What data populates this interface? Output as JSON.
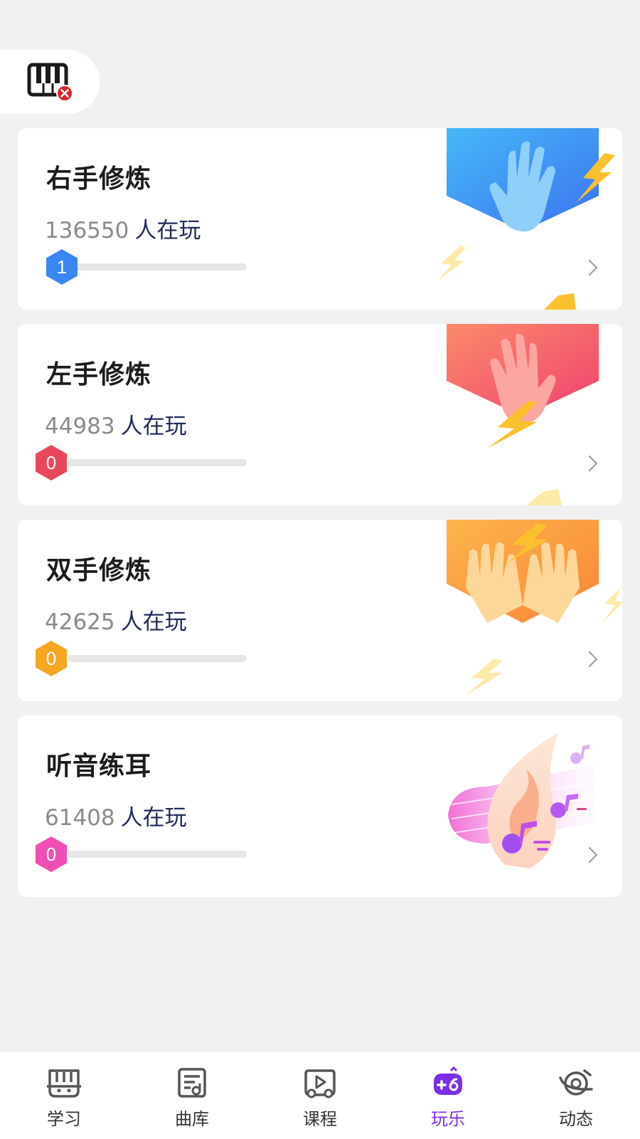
{
  "top": {
    "piano_status_icon": "piano-disconnected-icon"
  },
  "cards": [
    {
      "title": "右手修炼",
      "players": "136550",
      "players_suffix": "人在玩",
      "level": "1",
      "level_color": "#3a86f0",
      "art_icon": "right-hand-icon",
      "art_colors": [
        "#4ab6f7",
        "#3f7af0"
      ]
    },
    {
      "title": "左手修炼",
      "players": "44983",
      "players_suffix": "人在玩",
      "level": "0",
      "level_color": "#e8475c",
      "art_icon": "left-hand-icon",
      "art_colors": [
        "#f98a6c",
        "#f1456e"
      ]
    },
    {
      "title": "双手修炼",
      "players": "42625",
      "players_suffix": "人在玩",
      "level": "0",
      "level_color": "#f5a623",
      "art_icon": "both-hands-icon",
      "art_colors": [
        "#fdb44b",
        "#f98a3a"
      ]
    },
    {
      "title": "听音练耳",
      "players": "61408",
      "players_suffix": "人在玩",
      "level": "0",
      "level_color": "#ef4fb4",
      "art_icon": "music-notes-icon",
      "art_colors": [
        "#f070d8",
        "#a35af0"
      ]
    }
  ],
  "tabs": [
    {
      "label": "学习",
      "icon": "study-icon",
      "active": false
    },
    {
      "label": "曲库",
      "icon": "song-library-icon",
      "active": false
    },
    {
      "label": "课程",
      "icon": "course-icon",
      "active": false
    },
    {
      "label": "玩乐",
      "icon": "game-icon",
      "active": true
    },
    {
      "label": "动态",
      "icon": "feed-icon",
      "active": false
    }
  ],
  "colors": {
    "accent": "#7a2fe6",
    "background": "#f1f1f1"
  }
}
